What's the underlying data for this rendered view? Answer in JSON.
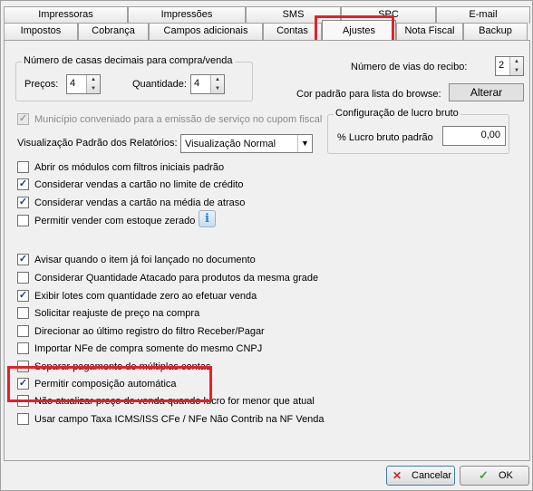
{
  "tabs_row1": [
    "Impressoras",
    "Impressões",
    "SMS",
    "SPC",
    "E-mail"
  ],
  "tabs_row2": [
    "Impostos",
    "Cobrança",
    "Campos adicionais",
    "Contas",
    "Ajustes",
    "Nota Fiscal",
    "Backup"
  ],
  "decimals": {
    "legend": "Número de casas decimais para compra/venda",
    "precos_label": "Preços:",
    "precos_value": "4",
    "quantidade_label": "Quantidade:",
    "quantidade_value": "4"
  },
  "vias": {
    "label": "Número de vias do recibo:",
    "value": "2"
  },
  "browse_color": {
    "label": "Cor padrão para lista do browse:",
    "button": "Alterar"
  },
  "municipio": {
    "label": "Município conveniado para a emissão de serviço no cupom fiscal",
    "checked": true
  },
  "relatorios": {
    "label": "Visualização Padrão dos Relatórios:",
    "value": "Visualização Normal"
  },
  "lucro": {
    "legend": "Configuração de lucro bruto",
    "label": "% Lucro bruto padrão",
    "value": "0,00"
  },
  "options_a": [
    {
      "label": "Abrir os módulos com filtros iniciais padrão",
      "checked": false
    },
    {
      "label": "Considerar vendas a cartão no limite de crédito",
      "checked": true
    },
    {
      "label": "Considerar vendas a cartão na média de atraso",
      "checked": true
    },
    {
      "label": "Permitir vender com estoque zerado",
      "checked": false
    }
  ],
  "info_icon": "i",
  "options_b": [
    {
      "label": "Avisar quando o item já foi lançado no documento",
      "checked": true
    },
    {
      "label": "Considerar Quantidade Atacado para produtos da mesma grade",
      "checked": false
    },
    {
      "label": "Exibir lotes com quantidade zero ao efetuar venda",
      "checked": true
    },
    {
      "label": "Solicitar reajuste de preço na compra",
      "checked": false
    },
    {
      "label": "Direcionar ao último registro do filtro Receber/Pagar",
      "checked": false
    },
    {
      "label": "Importar NFe de compra somente do mesmo CNPJ",
      "checked": false
    },
    {
      "label": "Separar pagamento de múltiplas contas",
      "checked": false
    },
    {
      "label": "Permitir composição automática",
      "checked": true
    },
    {
      "label": "Não atualizar preço de venda quando lucro for menor que atual",
      "checked": false
    },
    {
      "label": "Usar campo Taxa ICMS/ISS CFe / NFe Não Contrib na NF Venda",
      "checked": false
    }
  ],
  "footer": {
    "cancel": "Cancelar",
    "ok": "OK"
  },
  "colors": {
    "highlight": "#e5202a",
    "check": "#21398e",
    "ok_icon": "#3aa53a",
    "cancel_icon": "#c03030"
  }
}
